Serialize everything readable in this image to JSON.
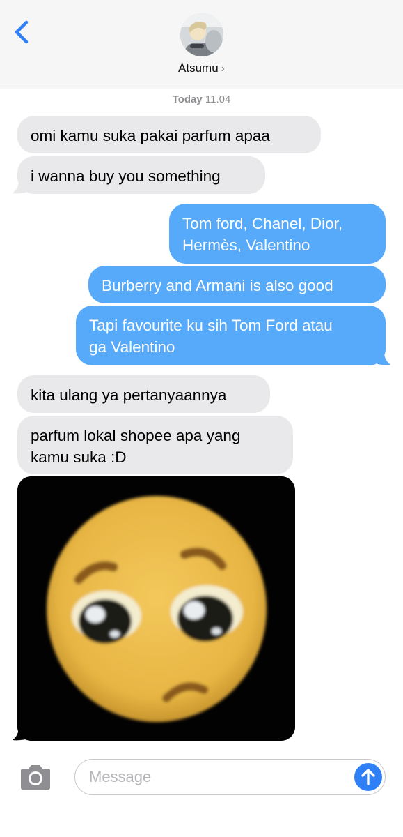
{
  "header": {
    "back_icon": "chevron-left-icon",
    "contact_name": "Atsumu",
    "contact_chevron": "›"
  },
  "thread": {
    "day": "Today",
    "time": "11.04",
    "messages": [
      {
        "direction": "incoming",
        "text": "omi kamu suka pakai parfum apaa"
      },
      {
        "direction": "incoming",
        "text": "i wanna buy you something"
      },
      {
        "direction": "outgoing",
        "lines": [
          "Tom ford, Chanel, Dior,",
          "Hermès, Valentino"
        ]
      },
      {
        "direction": "outgoing",
        "text": "Burberry and Armani is also good"
      },
      {
        "direction": "outgoing",
        "lines": [
          "Tapi favourite ku sih Tom Ford atau",
          "ga Valentino"
        ]
      },
      {
        "direction": "incoming",
        "text": "kita ulang ya pertanyaannya"
      },
      {
        "direction": "incoming",
        "lines": [
          "parfum lokal shopee apa yang",
          "kamu suka :D"
        ]
      },
      {
        "direction": "incoming",
        "type": "image",
        "image": "pleading-face-emoji"
      }
    ]
  },
  "composer": {
    "camera_icon": "camera-icon",
    "placeholder": "Message",
    "value": "",
    "send_icon": "arrow-up-icon"
  },
  "colors": {
    "incoming_bubble": "#e9e9eb",
    "outgoing_bubble": "#57a9f9",
    "send_button": "#2f7ff6",
    "accent": "#2f7ff6"
  }
}
